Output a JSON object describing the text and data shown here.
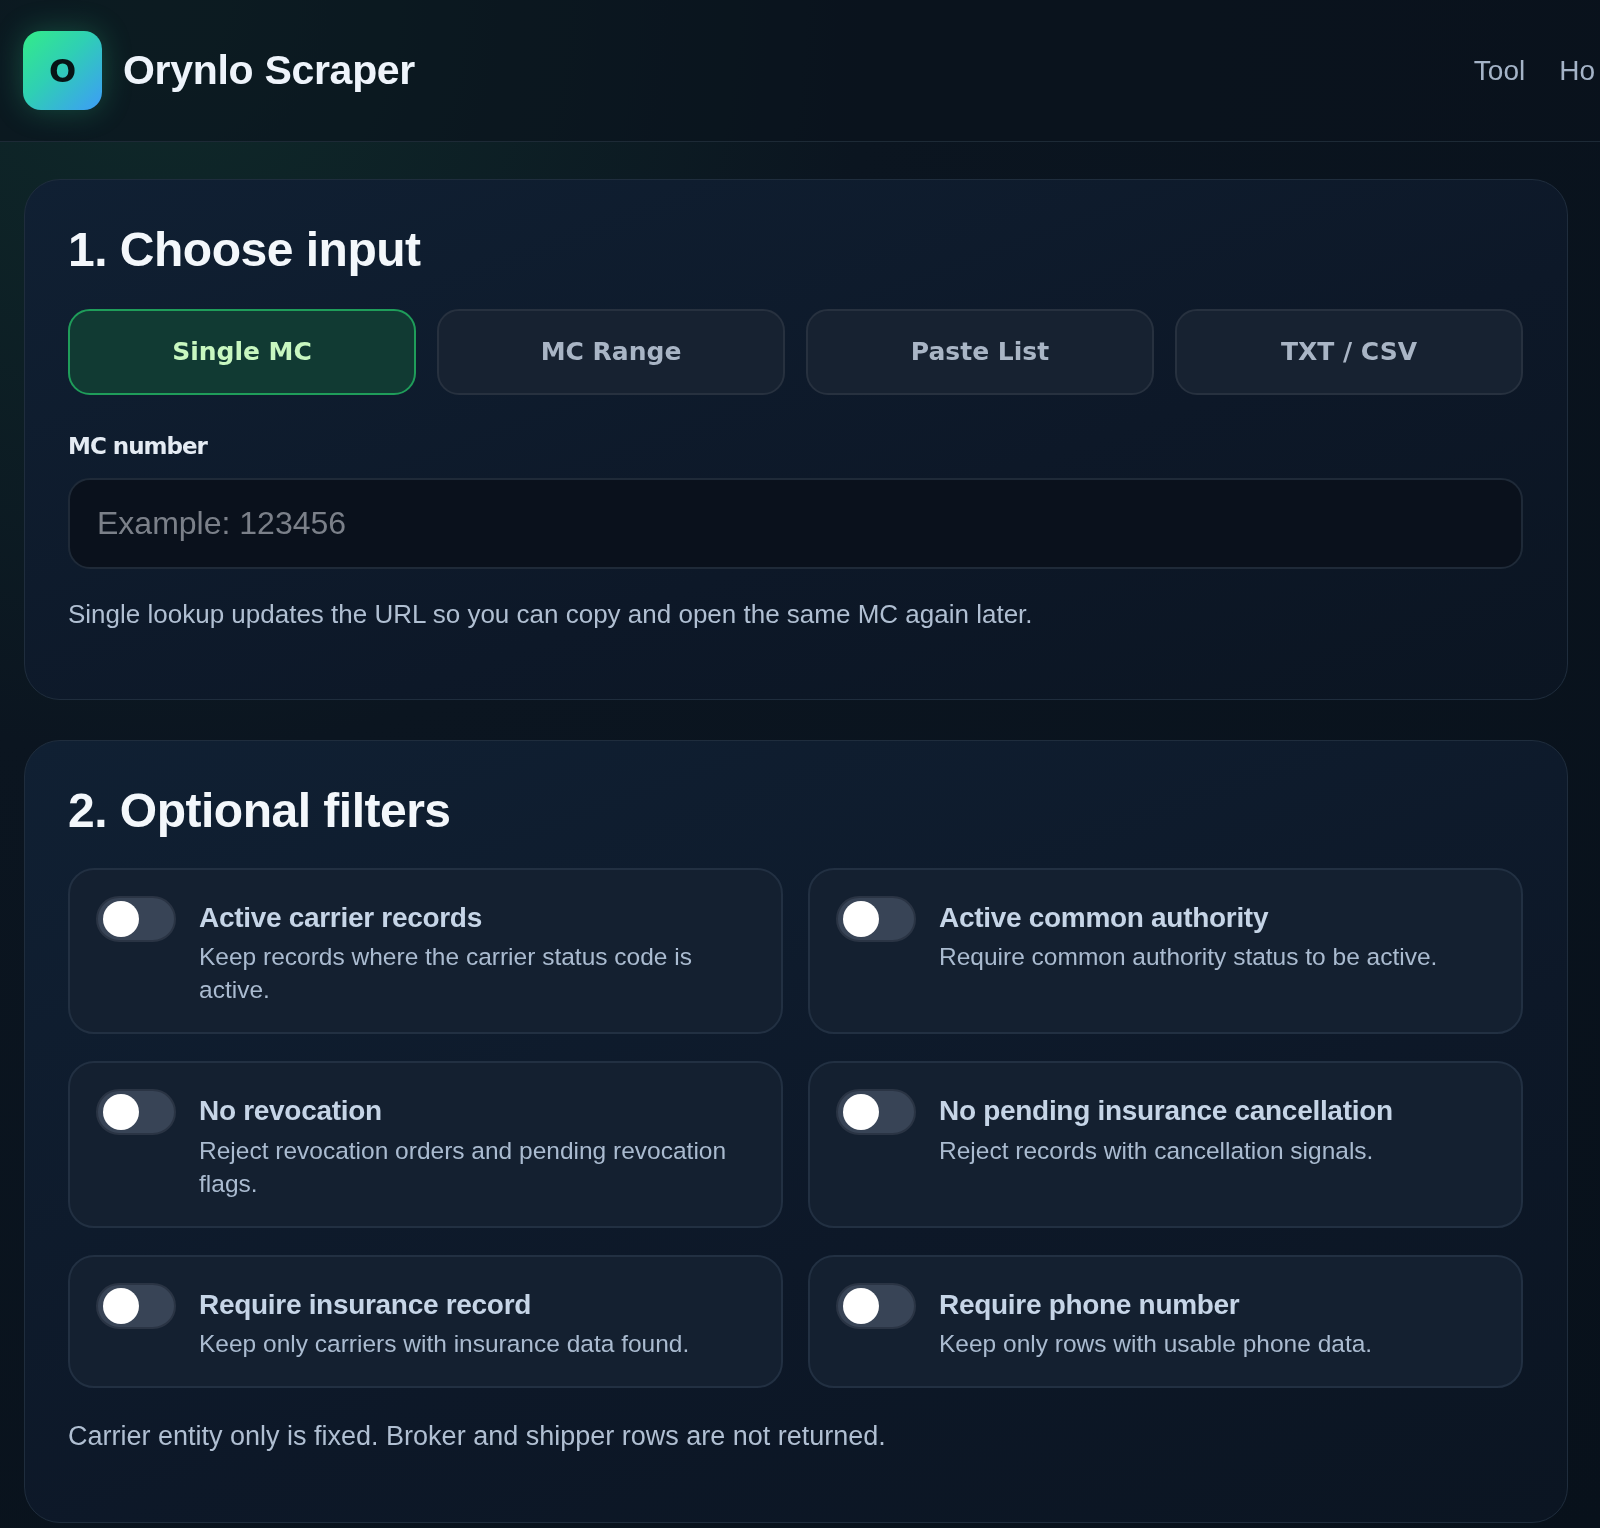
{
  "header": {
    "logo": {
      "letter": "O"
    },
    "title": "Orynlo Scraper",
    "nav": [
      {
        "label": "Tool"
      },
      {
        "label": "Ho"
      }
    ]
  },
  "input_section": {
    "heading": "1. Choose input",
    "tabs": [
      {
        "label": "Single MC",
        "selected": true
      },
      {
        "label": "MC Range",
        "selected": false
      },
      {
        "label": "Paste List",
        "selected": false
      },
      {
        "label": "TXT / CSV",
        "selected": false
      }
    ],
    "field": {
      "label": "MC number",
      "placeholder": "Example: 123456"
    },
    "help": "Single lookup updates the URL so you can copy and open the same MC again later."
  },
  "filters_section": {
    "heading": "2. Optional filters",
    "filters": [
      {
        "title": "Active carrier records",
        "description": "Keep records where the carrier status code is active.",
        "on": false
      },
      {
        "title": "Active common authority",
        "description": "Require common authority status to be active.",
        "on": false
      },
      {
        "title": "No revocation",
        "description": "Reject revocation orders and pending revocation flags.",
        "on": false
      },
      {
        "title": "No pending insurance cancellation",
        "description": "Reject records with cancellation signals.",
        "on": false
      },
      {
        "title": "Require insurance record",
        "description": "Keep only carriers with insurance data found.",
        "on": false
      },
      {
        "title": "Require phone number",
        "description": "Keep only rows with usable phone data.",
        "on": false
      }
    ],
    "note": "Carrier entity only is fixed. Broker and shipper rows are not returned."
  }
}
